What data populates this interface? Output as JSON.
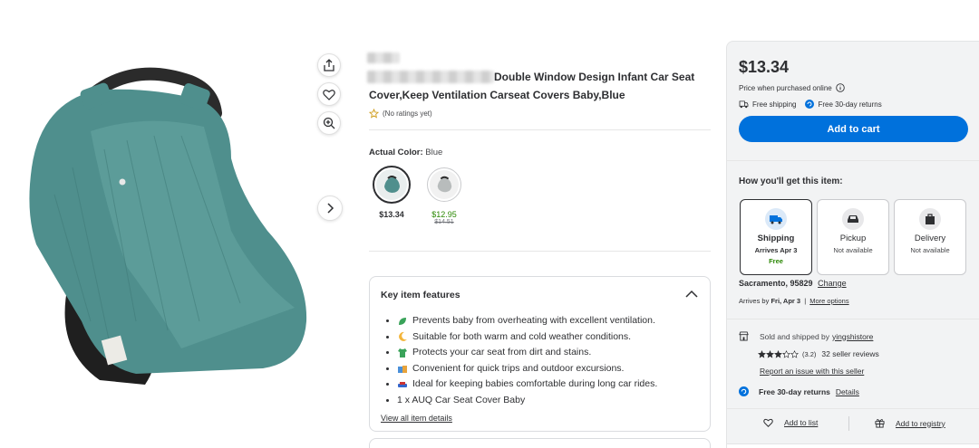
{
  "gallery": {
    "share_icon": "share-icon",
    "favorite_icon": "heart-icon",
    "zoom_icon": "zoom-in-icon",
    "next_icon": "chevron-right-icon"
  },
  "product": {
    "title_line1": "Double Window Design Infant Car Seat",
    "title_line2": "Cover,Keep Ventilation Carseat Covers Baby,Blue",
    "ratings": "(No ratings yet)",
    "color_label": "Actual Color:",
    "color_value": "Blue",
    "variants": [
      {
        "price": "$13.34",
        "was": ""
      },
      {
        "price": "$12.95",
        "was": "$14.51"
      }
    ]
  },
  "features": {
    "heading": "Key item features",
    "items": [
      "Prevents baby from overheating with excellent ventilation.",
      "Suitable for both warm and cold weather conditions.",
      "Protects your car seat from dirt and stains.",
      "Convenient for quick trips and outdoor excursions.",
      "Ideal for keeping babies comfortable during long car rides.",
      "1 x AUQ Car Seat Cover Baby"
    ],
    "view_all": "View all item details"
  },
  "buy_box": {
    "price": "$13.34",
    "price_note": "Price when purchased online",
    "free_shipping": "Free shipping",
    "free_returns": "Free 30-day returns",
    "add_to_cart": "Add to cart",
    "how_heading": "How you'll get this item:",
    "options": [
      {
        "name": "Shipping",
        "line1": "Arrives Apr 3",
        "line2": "Free"
      },
      {
        "name": "Pickup",
        "line1": "Not available",
        "line2": ""
      },
      {
        "name": "Delivery",
        "line1": "Not available",
        "line2": ""
      }
    ],
    "location": "Sacramento, 95829",
    "change": "Change",
    "arrives_prefix": "Arrives by",
    "arrives_date": "Fri, Apr 3",
    "more_options": "More options",
    "sold_by_prefix": "Sold and shipped by",
    "seller": "yingshistore",
    "seller_rating": "(3.2)",
    "seller_rating_value": 3.2,
    "seller_reviews": "32 seller reviews",
    "report_issue": "Report an issue with this seller",
    "returns": "Free 30-day returns",
    "returns_details": "Details",
    "add_to_list": "Add to list",
    "add_to_registry": "Add to registry"
  },
  "colors": {
    "accent": "#0071dc",
    "price_sale": "#2a8703",
    "product": "#4f8f8d"
  }
}
